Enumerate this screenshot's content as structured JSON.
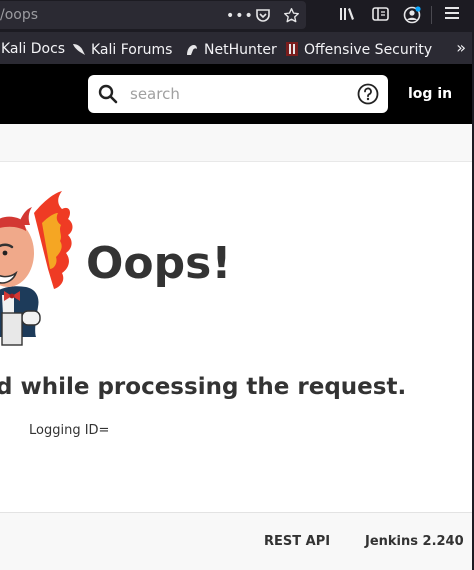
{
  "browser": {
    "url_fragment": "/oops",
    "toolbar_icons": [
      "more-dots-icon",
      "pocket-icon",
      "bookmark-star-icon",
      "library-icon",
      "reader-view-icon",
      "account-icon",
      "hamburger-menu-icon"
    ],
    "bookmarks": [
      {
        "label": "Kali Docs",
        "icon": "kali-dragon-icon"
      },
      {
        "label": "Kali Forums",
        "icon": "kali-dragon-icon"
      },
      {
        "label": "NetHunter",
        "icon": "nethunter-icon"
      },
      {
        "label": "Offensive Security",
        "icon": "offsec-icon"
      }
    ],
    "bookmarks_overflow": "»"
  },
  "header": {
    "search_placeholder": "search",
    "login_label": "log in"
  },
  "main": {
    "title": "Oops!",
    "error_message": "d while processing the request.",
    "logging_label": "Logging ID="
  },
  "footer": {
    "rest_api_label": "REST API",
    "version_label": "Jenkins 2.240"
  },
  "colors": {
    "header_bg": "#000000",
    "browser_toolbar": "#1c1b22",
    "bookmarks_bg": "#2b2a33",
    "text": "#333333"
  }
}
